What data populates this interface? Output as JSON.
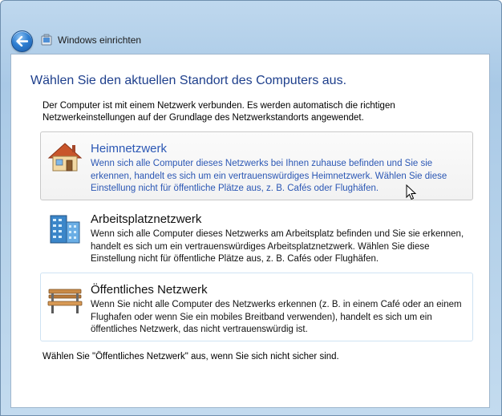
{
  "window": {
    "title": "Windows einrichten"
  },
  "page": {
    "heading": "Wählen Sie den aktuellen Standort des Computers aus.",
    "intro": "Der Computer ist mit einem Netzwerk verbunden. Es werden automatisch die richtigen Netzwerkeinstellungen auf der Grundlage des Netzwerkstandorts angewendet.",
    "footer": "Wählen Sie \"Öffentliches Netzwerk\" aus, wenn Sie sich nicht sicher sind."
  },
  "options": [
    {
      "icon": "house-icon",
      "title": "Heimnetzwerk",
      "description": "Wenn sich alle Computer dieses Netzwerks bei Ihnen zuhause befinden und Sie sie erkennen, handelt es sich um ein vertrauenswürdiges Heimnetzwerk. Wählen Sie diese Einstellung nicht für öffentliche Plätze aus, z. B. Cafés oder Flughäfen."
    },
    {
      "icon": "office-building-icon",
      "title": "Arbeitsplatznetzwerk",
      "description": "Wenn sich alle Computer dieses Netzwerks am Arbeitsplatz befinden und Sie sie erkennen, handelt es sich um ein vertrauenswürdiges Arbeitsplatznetzwerk. Wählen Sie diese Einstellung nicht für öffentliche Plätze aus, z. B. Cafés oder Flughäfen."
    },
    {
      "icon": "park-bench-icon",
      "title": "Öffentliches Netzwerk",
      "description": "Wenn Sie nicht alle Computer des Netzwerks erkennen (z. B. in einem Café oder an einem Flughafen oder wenn Sie ein mobiles Breitband verwenden), handelt es sich um ein öffentliches Netzwerk, das nicht vertrauenswürdig ist."
    }
  ],
  "colors": {
    "heading": "#1e3f8c",
    "link_blue": "#2b57b4",
    "frame": "#b6d2ea"
  }
}
